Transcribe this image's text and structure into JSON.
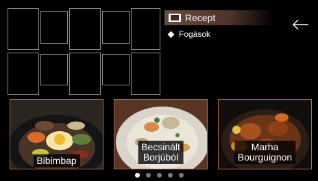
{
  "menu": {
    "title": "Recept",
    "item": "Fogások",
    "title_icon": "book-icon",
    "item_icon": "diamond-icon"
  },
  "back_icon": "arrow-left-icon",
  "cards": [
    {
      "label": "Bibimbap"
    },
    {
      "label": "Becsinált\nBorjúból"
    },
    {
      "label": "Marha\nBourguignon"
    }
  ],
  "pagination": {
    "total": 5,
    "active": 1
  },
  "colors": {
    "menu_highlight": "#6b4a3e",
    "card_border": "#b06a4e",
    "tile_border": "#8a8a8a"
  }
}
